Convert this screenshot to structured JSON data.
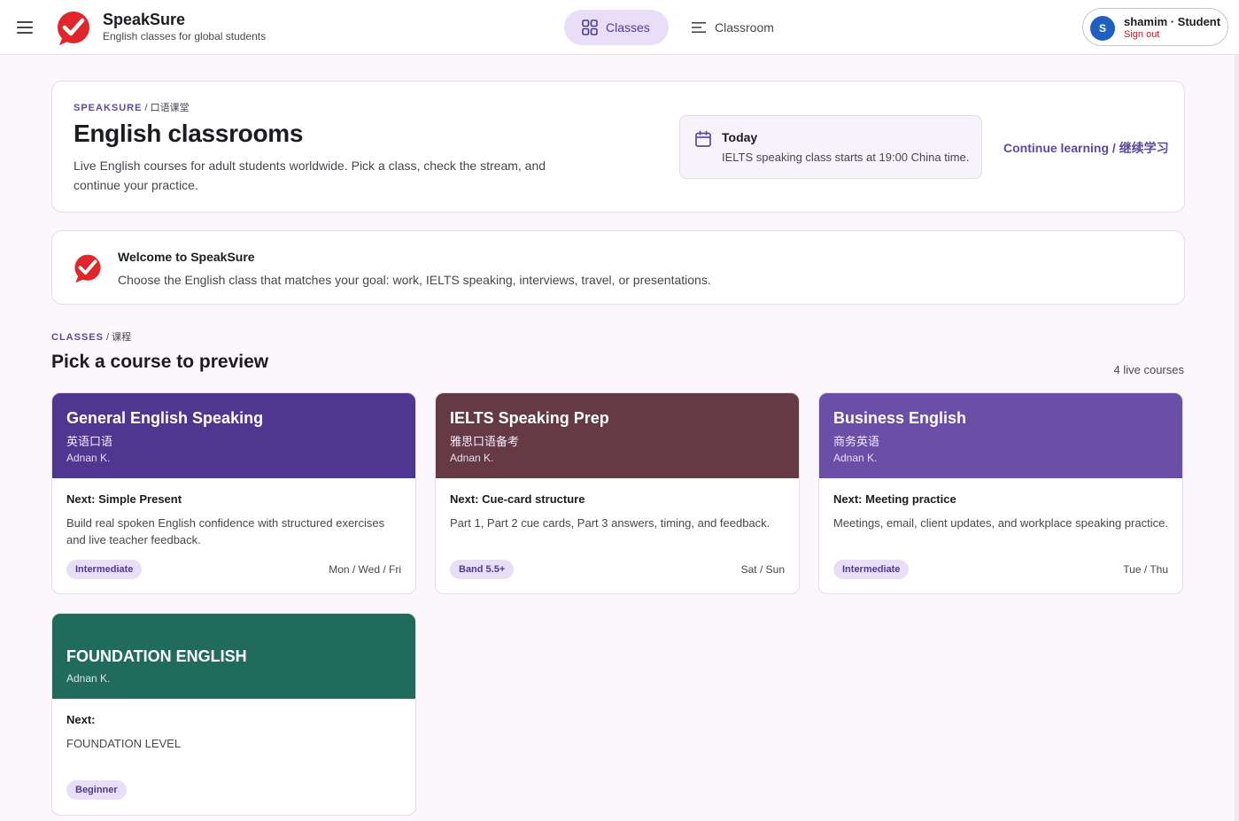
{
  "app": {
    "name": "SpeakSure",
    "tagline": "English classes for global students"
  },
  "nav": {
    "classes_label": "Classes",
    "classroom_label": "Classroom"
  },
  "user": {
    "initial": "S",
    "display": "shamim · Student",
    "sign_out": "Sign out"
  },
  "hero": {
    "eyebrow_main": "SPEAKSURE",
    "eyebrow_sep": " / ",
    "eyebrow_cn": "口语课堂",
    "title": "English classrooms",
    "description": "Live English courses for adult students worldwide. Pick a class, check the stream, and continue your practice.",
    "today_title": "Today",
    "today_text": "IELTS speaking class starts at 19:00 China time.",
    "continue_label": "Continue learning / 继续学习"
  },
  "welcome": {
    "title": "Welcome to SpeakSure",
    "text": "Choose the English class that matches your goal: work, IELTS speaking, interviews, travel, or presentations."
  },
  "section": {
    "eyebrow_main": "CLASSES",
    "eyebrow_sep": " / ",
    "eyebrow_cn": "课程",
    "title": "Pick a course to preview",
    "count": "4 live courses"
  },
  "courses": [
    {
      "title": "General English Speaking",
      "title_cn": "英语口语",
      "teacher": "Adnan K.",
      "next": "Next: Simple Present",
      "description": "Build real spoken English confidence with structured exercises and live teacher feedback.",
      "level": "Intermediate",
      "days": "Mon / Wed / Fri",
      "color": "#4f3690"
    },
    {
      "title": "IELTS Speaking Prep",
      "title_cn": "雅思口语备考",
      "teacher": "Adnan K.",
      "next": "Next: Cue-card structure",
      "description": "Part 1, Part 2 cue cards, Part 3 answers, timing, and feedback.",
      "level": "Band 5.5+",
      "days": "Sat / Sun",
      "color": "#663a45"
    },
    {
      "title": "Business English",
      "title_cn": "商务英语",
      "teacher": "Adnan K.",
      "next": "Next: Meeting practice",
      "description": "Meetings, email, client updates, and workplace speaking practice.",
      "level": "Intermediate",
      "days": "Tue / Thu",
      "color": "#6b4ea8"
    },
    {
      "title": "FOUNDATION ENGLISH",
      "title_cn": "",
      "teacher": "Adnan K.",
      "next": "Next:",
      "description": "FOUNDATION LEVEL",
      "level": "Beginner",
      "days": "",
      "color": "#216b5c"
    }
  ]
}
